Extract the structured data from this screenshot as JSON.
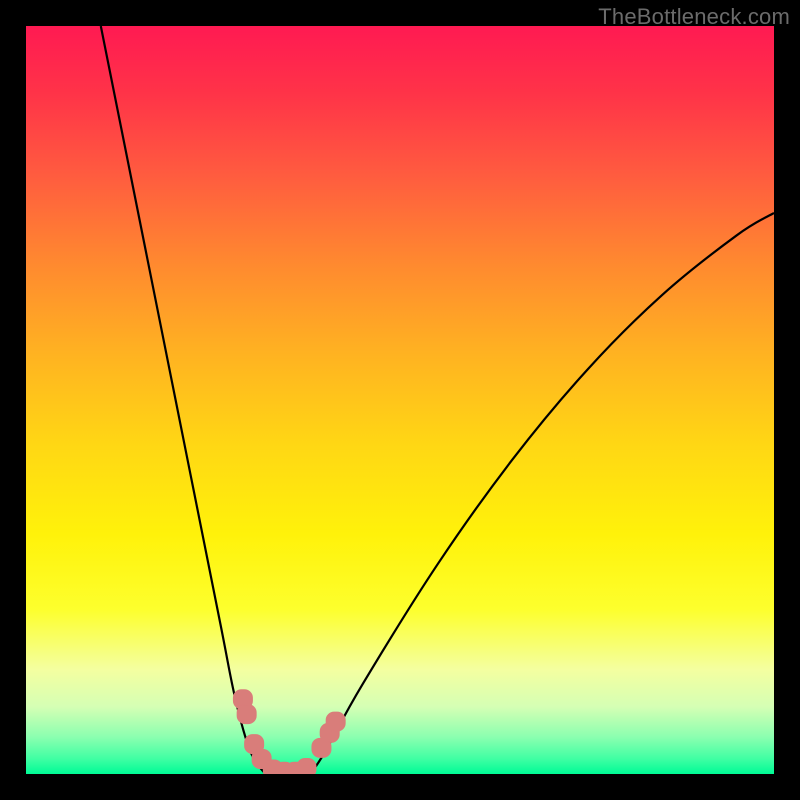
{
  "watermark": "TheBottleneck.com",
  "colors": {
    "curve_stroke": "#000000",
    "marker_fill": "#d97d7a",
    "marker_stroke": "#d97d7a"
  },
  "chart_data": {
    "type": "line",
    "title": "",
    "xlabel": "",
    "ylabel": "",
    "xlim": [
      0,
      100
    ],
    "ylim": [
      0,
      100
    ],
    "left_curve": [
      {
        "x": 10,
        "y": 100
      },
      {
        "x": 14,
        "y": 80
      },
      {
        "x": 18,
        "y": 60
      },
      {
        "x": 22,
        "y": 40
      },
      {
        "x": 26,
        "y": 20
      },
      {
        "x": 28,
        "y": 10
      },
      {
        "x": 30,
        "y": 3
      },
      {
        "x": 32,
        "y": 0
      }
    ],
    "right_curve": [
      {
        "x": 38,
        "y": 0
      },
      {
        "x": 40,
        "y": 3
      },
      {
        "x": 45,
        "y": 12
      },
      {
        "x": 55,
        "y": 28
      },
      {
        "x": 65,
        "y": 42
      },
      {
        "x": 75,
        "y": 54
      },
      {
        "x": 85,
        "y": 64
      },
      {
        "x": 95,
        "y": 72
      },
      {
        "x": 100,
        "y": 75
      }
    ],
    "markers": [
      {
        "x": 29.0,
        "y": 10.0
      },
      {
        "x": 29.5,
        "y": 8.0
      },
      {
        "x": 30.5,
        "y": 4.0
      },
      {
        "x": 31.5,
        "y": 2.0
      },
      {
        "x": 33.0,
        "y": 0.6
      },
      {
        "x": 34.5,
        "y": 0.3
      },
      {
        "x": 36.0,
        "y": 0.3
      },
      {
        "x": 37.5,
        "y": 0.8
      },
      {
        "x": 39.5,
        "y": 3.5
      },
      {
        "x": 40.6,
        "y": 5.5
      },
      {
        "x": 41.4,
        "y": 7.0
      }
    ]
  }
}
